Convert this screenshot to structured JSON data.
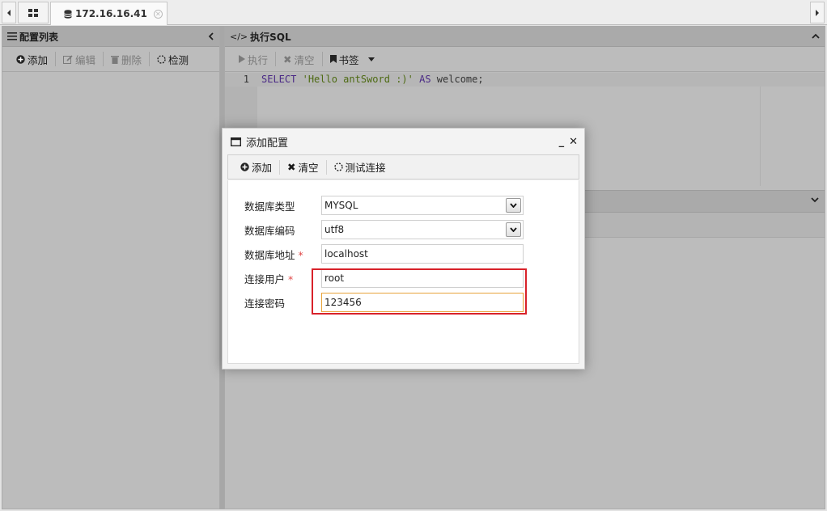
{
  "tabs": {
    "active_label": "172.16.16.41"
  },
  "left_panel": {
    "title": "配置列表",
    "toolbar": {
      "add": "添加",
      "edit": "编辑",
      "delete": "删除",
      "check": "检测"
    }
  },
  "right_panel": {
    "title": "执行SQL",
    "toolbar": {
      "run": "执行",
      "clear": "清空",
      "bookmark": "书签"
    },
    "editor": {
      "line_number": "1",
      "code": {
        "kw1": "SELECT",
        "str": "'Hello antSword :)'",
        "kw2": "AS",
        "rest": "welcome;"
      }
    }
  },
  "modal": {
    "title": "添加配置",
    "minimize": "_",
    "close": "✕",
    "toolbar": {
      "add": "添加",
      "clear": "清空",
      "test": "测试连接"
    },
    "form": {
      "db_type": {
        "label": "数据库类型",
        "value": "MYSQL"
      },
      "db_encoding": {
        "label": "数据库编码",
        "value": "utf8"
      },
      "db_host": {
        "label": "数据库地址",
        "value": "localhost",
        "required_mark": "*"
      },
      "db_user": {
        "label": "连接用户",
        "value": "root",
        "required_mark": "*"
      },
      "db_password": {
        "label": "连接密码",
        "value": "123456"
      }
    }
  },
  "colors": {
    "highlight_border": "#d8222a",
    "required_star": "#e04848",
    "focus_border": "#e8a33a",
    "sql_keyword": "#4b2a86",
    "sql_string": "#4d6a12"
  }
}
